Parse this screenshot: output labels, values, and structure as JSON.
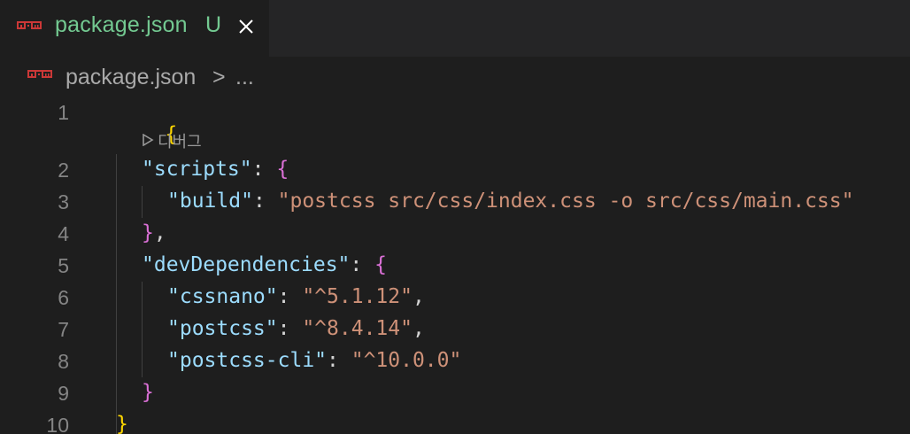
{
  "tab": {
    "filename": "package.json",
    "status": "U",
    "icon": "npm-icon",
    "close_icon": "close-icon",
    "title_color": "#73c991"
  },
  "breadcrumb": {
    "file": "package.json",
    "separator": ">",
    "more": "..."
  },
  "codelens": {
    "label": "디버그",
    "icon": "play-icon"
  },
  "editor": {
    "line_numbers": [
      "1",
      "2",
      "3",
      "4",
      "5",
      "6",
      "7",
      "8",
      "9",
      "10"
    ],
    "lines": [
      {
        "open": "{"
      },
      {
        "key": "\"scripts\"",
        "colon": ": ",
        "open": "{"
      },
      {
        "key": "\"build\"",
        "colon": ": ",
        "value": "\"postcss src/css/index.css -o src/css/main.css\""
      },
      {
        "close": "}",
        "tail": ","
      },
      {
        "key": "\"devDependencies\"",
        "colon": ": ",
        "open": "{"
      },
      {
        "key": "\"cssnano\"",
        "colon": ": ",
        "value": "\"^5.1.12\"",
        "tail": ","
      },
      {
        "key": "\"postcss\"",
        "colon": ": ",
        "value": "\"^8.4.14\"",
        "tail": ","
      },
      {
        "key": "\"postcss-cli\"",
        "colon": ": ",
        "value": "\"^10.0.0\""
      },
      {
        "close": "}"
      },
      {
        "close": "}"
      }
    ]
  },
  "colors": {
    "background": "#1e1e1e",
    "tabbar": "#252526",
    "json_key": "#9cdcfe",
    "json_string": "#ce9178",
    "bracket_level1": "#ffd700",
    "bracket_level2": "#da70d6",
    "npm_icon": "#cb3837"
  }
}
